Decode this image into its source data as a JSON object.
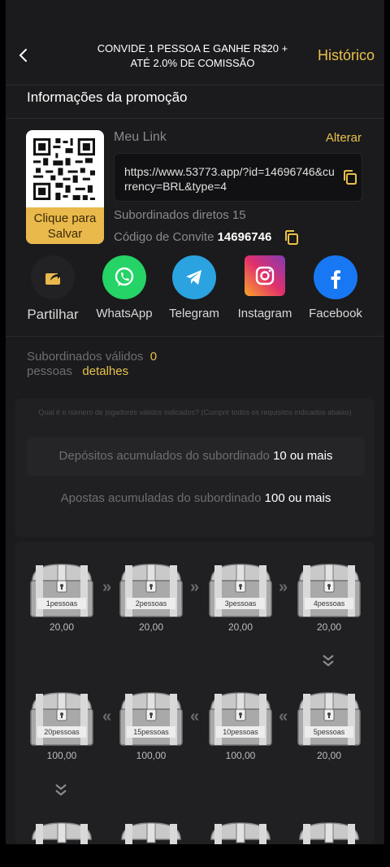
{
  "header": {
    "title_line1": "CONVIDE 1 PESSOA E GANHE R$20 +",
    "title_line2": "ATÉ 2.0% DE COMISSÃO",
    "history_label": "Histórico"
  },
  "promo": {
    "section_title": "Informações da promoção",
    "qr_save_line1": "Clique para",
    "qr_save_line2": "Salvar",
    "link_label": "Meu Link",
    "change_label": "Alterar",
    "link_url": "https://www.53773.app/?id=14696746&currency=BRL&type=4",
    "direct_subordinates": "Subordinados diretos 15",
    "invite_code_label": "Código de Convite",
    "invite_code": "14696746"
  },
  "share": [
    {
      "label": "Partilhar",
      "icon": "share-icon"
    },
    {
      "label": "WhatsApp",
      "icon": "whatsapp-icon"
    },
    {
      "label": "Telegram",
      "icon": "telegram-icon"
    },
    {
      "label": "Instagram",
      "icon": "instagram-icon"
    },
    {
      "label": "Facebook",
      "icon": "facebook-icon"
    }
  ],
  "valid": {
    "label_line1": "Subordinados válidos",
    "count": "0",
    "label_line2": "pessoas",
    "details": "detalhes"
  },
  "requirements": {
    "question": "Qual é o número de jogadores válidos indicados? (Cumprir todos os requisitos indicados abaixo)",
    "deposit_label": "Depósitos acumulados do subordinado",
    "deposit_value": "10 ou mais",
    "bet_label": "Apostas acumuladas do subordinado",
    "bet_value": "100 ou mais"
  },
  "chests": {
    "row1": [
      {
        "label": "1pessoas",
        "amount": "20,00"
      },
      {
        "label": "2pessoas",
        "amount": "20,00"
      },
      {
        "label": "3pessoas",
        "amount": "20,00"
      },
      {
        "label": "4pessoas",
        "amount": "20,00"
      }
    ],
    "row2": [
      {
        "label": "20pessoas",
        "amount": "100,00"
      },
      {
        "label": "15pessoas",
        "amount": "100,00"
      },
      {
        "label": "10pessoas",
        "amount": "100,00"
      },
      {
        "label": "5pessoas",
        "amount": "20,00"
      }
    ]
  },
  "colors": {
    "accent": "#e9c14a",
    "background": "#1b1b1d",
    "whatsapp": "#25d366",
    "telegram": "#2aa3e0",
    "facebook": "#1877f2"
  }
}
